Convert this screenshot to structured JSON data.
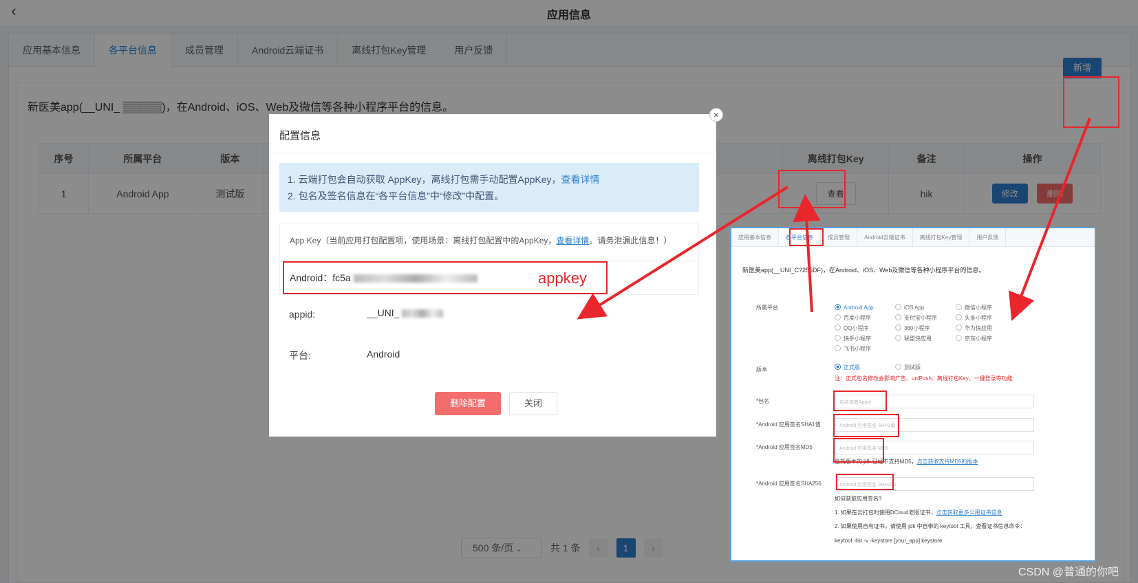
{
  "header": {
    "title": "应用信息",
    "back_icon": "chevron-left-icon"
  },
  "tabs": [
    {
      "label": "应用基本信息"
    },
    {
      "label": "各平台信息",
      "active": true
    },
    {
      "label": "成员管理"
    },
    {
      "label": "Android云端证书"
    },
    {
      "label": "离线打包Key管理"
    },
    {
      "label": "用户反馈"
    }
  ],
  "main": {
    "description": "新医美app(__UNI_ ▒▒▒▒▒)，在Android、iOS、Web及微信等各种小程序平台的信息。",
    "add_button": "新增"
  },
  "table": {
    "headers": [
      "序号",
      "所属平台",
      "版本",
      "离线打包Key",
      "备注",
      "操作"
    ],
    "rows": [
      {
        "index": "1",
        "platform": "Android App",
        "version": "测试版",
        "key_button": "查看",
        "remark": "hik",
        "edit": "修改",
        "delete": "删除"
      }
    ]
  },
  "pagination": {
    "page_size": "500 条/页",
    "total": "共 1 条",
    "current": "1"
  },
  "modal": {
    "title": "配置信息",
    "alert_line1": "1. 云端打包会自动获取 AppKey，离线打包需手动配置AppKey，",
    "alert_link": "查看详情",
    "alert_line2": "2. 包名及签名信息在“各平台信息”中“修改”中配置。",
    "appkey_head": "App Key（当前应用打包配置项，使用场景：离线打包配置中的AppKey，",
    "appkey_head_link": "查看详情",
    "appkey_head_tail": "。请务泄漏此信息！）",
    "android_label": "Android：fc5a",
    "appid_label": "appid:",
    "appid_value": "__UNI_",
    "platform_label": "平台:",
    "platform_value": "Android",
    "delete_button": "删除配置",
    "close_button": "关闭"
  },
  "annotation": {
    "appkey_text": "appkey"
  },
  "inset": {
    "tabs": [
      "应用基本信息",
      "各平台信息",
      "成员管理",
      "Android云端证书",
      "离线打包Key管理",
      "用户反馈"
    ],
    "description": "新医美app(__UNI_C?255DF)，在Android、iOS、Web及微信等各种小程序平台的信息。",
    "platform_label": "所属平台",
    "platforms": [
      "Android App",
      "iOS App",
      "微信小程序",
      "百度小程序",
      "支付宝小程序",
      "头条小程序",
      "QQ小程序",
      "360小程序",
      "华为快应用",
      "快手小程序",
      "联盟快应用",
      "京东小程序",
      "飞书小程序"
    ],
    "version_label": "版本",
    "version_options": [
      "正式版",
      "测试版"
    ],
    "version_note": "注：正式包名修改会影响广告、uniPush、离线打包Key、一键登录等功能",
    "package_label": "*包名",
    "package_placeholder": "包名或者Appid",
    "sha1_label": "*Android 应用签名SHA1值",
    "sha1_placeholder": "Android 应用签名 SHA1值",
    "md5_label": "*Android 应用签名MD5",
    "md5_placeholder": "Android 应用签名 MD5",
    "md5_note": "最新版本的 jdk 已经不支持MD5，",
    "md5_link": "点击获取支持MD5的版本",
    "sha256_label": "*Android 应用签名SHA256",
    "sha256_placeholder": "Android 应用签名 SHA256",
    "how_title": "如何获取应用签名?",
    "how1": "1. 如果在云打包时使用DCloud老版证书，",
    "how1_link": "点击获取更多公用证书信息",
    "how2": "2. 如果使用自有证书，请使用 jdk 中自带的 keytool 工具，查看证书信息命令：",
    "how3": "keytool -list -v -keystore [your_app].keystore"
  },
  "watermark": "CSDN @普通的你吧",
  "colors": {
    "accent": "#2f7fd0",
    "danger": "#f56c6c",
    "annotation": "#e8262c"
  }
}
